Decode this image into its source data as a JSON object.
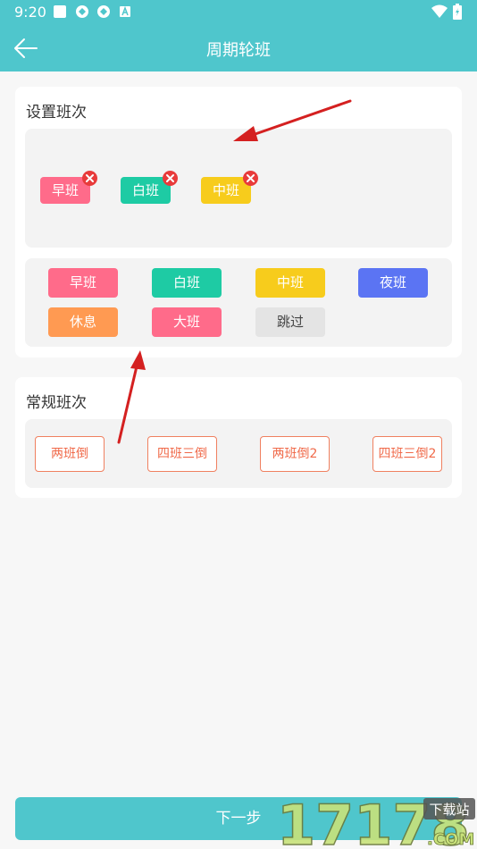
{
  "status_bar": {
    "time": "9:20"
  },
  "header": {
    "title": "周期轮班"
  },
  "set_shifts": {
    "title": "设置班次",
    "selected": [
      {
        "label": "早班",
        "color": "#ff6b8a"
      },
      {
        "label": "白班",
        "color": "#1ecba4"
      },
      {
        "label": "中班",
        "color": "#f7cc1c"
      }
    ],
    "options": [
      {
        "label": "早班",
        "color": "#ff6b8a"
      },
      {
        "label": "白班",
        "color": "#1ecba4"
      },
      {
        "label": "中班",
        "color": "#f7cc1c"
      },
      {
        "label": "夜班",
        "color": "#5b74f3"
      },
      {
        "label": "休息",
        "color": "#ff9a52"
      },
      {
        "label": "大班",
        "color": "#ff6b8a"
      },
      {
        "label": "跳过",
        "color": "#e4e4e4"
      }
    ]
  },
  "regular_shifts": {
    "title": "常规班次",
    "items": [
      "两班倒",
      "四班三倒",
      "两班倒2",
      "四班三倒2"
    ]
  },
  "footer": {
    "next_label": "下一步"
  },
  "watermark": {
    "number": "17178",
    "site": "下载站",
    "domain": ".COM"
  }
}
